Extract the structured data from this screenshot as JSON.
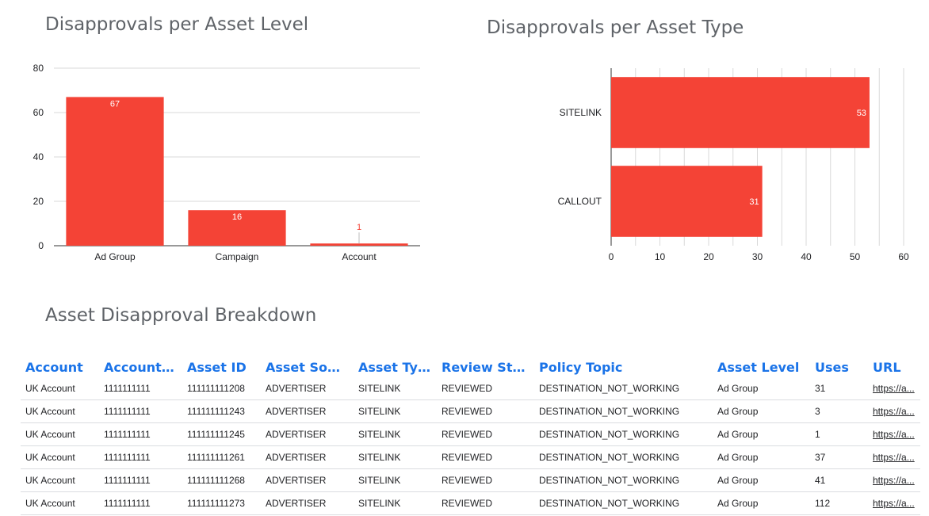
{
  "titles": {
    "level": "Disapprovals per Asset Level",
    "type": "Disapprovals per Asset Type",
    "table": "Asset Disapproval Breakdown"
  },
  "colors": {
    "bar": "#f44336",
    "header": "#1a73e8",
    "grid": "#d9d9d9"
  },
  "chart_data": [
    {
      "type": "bar",
      "title": "Disapprovals per Asset Level",
      "categories": [
        "Ad Group",
        "Campaign",
        "Account"
      ],
      "values": [
        67,
        16,
        1
      ],
      "ylim": [
        0,
        80
      ],
      "yticks": [
        0,
        20,
        40,
        60,
        80
      ],
      "grid": true,
      "orientation": "vertical"
    },
    {
      "type": "bar",
      "title": "Disapprovals per Asset Type",
      "categories": [
        "SITELINK",
        "CALLOUT"
      ],
      "values": [
        53,
        31
      ],
      "xlim": [
        0,
        60
      ],
      "xticks": [
        0,
        10,
        20,
        30,
        40,
        50,
        60
      ],
      "grid": true,
      "orientation": "horizontal"
    }
  ],
  "table": {
    "columns": [
      "Account",
      "Account I...",
      "Asset ID",
      "Asset Sour...",
      "Asset Typ...",
      "Review Stat...",
      "Policy Topic",
      "Asset Level",
      "Uses",
      "URL"
    ],
    "rows": [
      [
        "UK Account",
        "1111111111",
        "111111111208",
        "ADVERTISER",
        "SITELINK",
        "REVIEWED",
        "DESTINATION_NOT_WORKING",
        "Ad Group",
        "31",
        "https://a..."
      ],
      [
        "UK Account",
        "1111111111",
        "111111111243",
        "ADVERTISER",
        "SITELINK",
        "REVIEWED",
        "DESTINATION_NOT_WORKING",
        "Ad Group",
        "3",
        "https://a..."
      ],
      [
        "UK Account",
        "1111111111",
        "111111111245",
        "ADVERTISER",
        "SITELINK",
        "REVIEWED",
        "DESTINATION_NOT_WORKING",
        "Ad Group",
        "1",
        "https://a..."
      ],
      [
        "UK Account",
        "1111111111",
        "111111111261",
        "ADVERTISER",
        "SITELINK",
        "REVIEWED",
        "DESTINATION_NOT_WORKING",
        "Ad Group",
        "37",
        "https://a..."
      ],
      [
        "UK Account",
        "1111111111",
        "111111111268",
        "ADVERTISER",
        "SITELINK",
        "REVIEWED",
        "DESTINATION_NOT_WORKING",
        "Ad Group",
        "41",
        "https://a..."
      ],
      [
        "UK Account",
        "1111111111",
        "111111111273",
        "ADVERTISER",
        "SITELINK",
        "REVIEWED",
        "DESTINATION_NOT_WORKING",
        "Ad Group",
        "112",
        "https://a..."
      ]
    ]
  }
}
